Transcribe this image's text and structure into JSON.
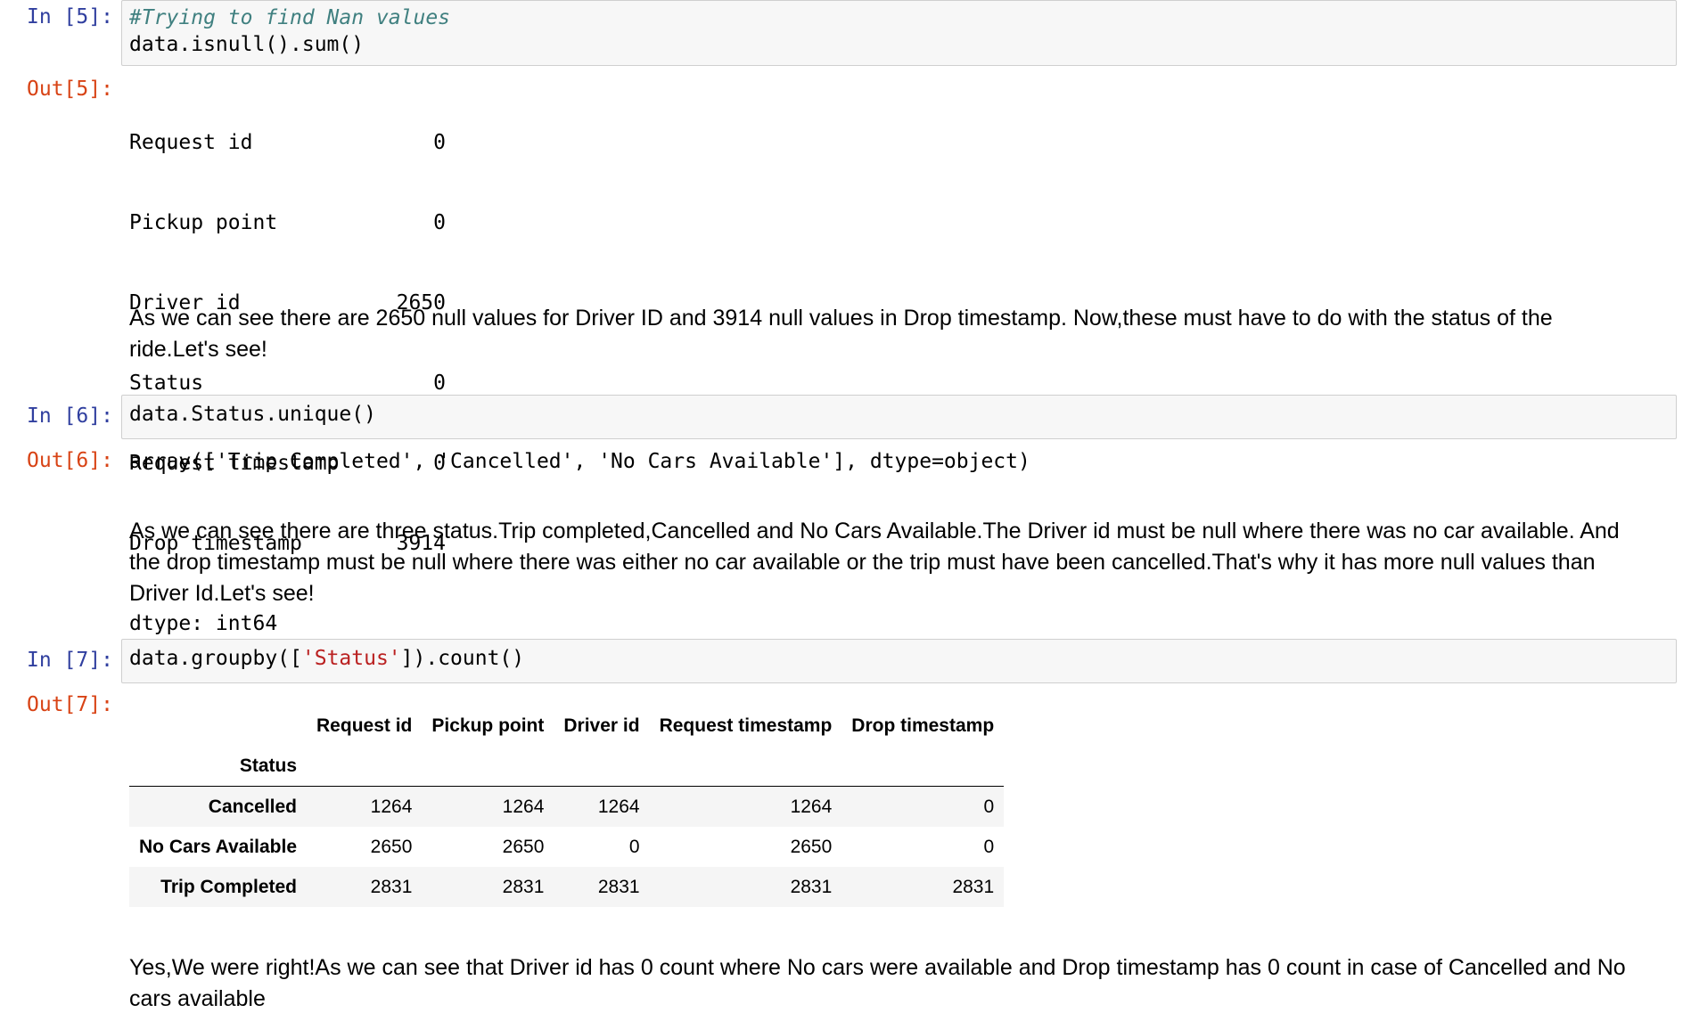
{
  "cells": {
    "in5": {
      "prompt": "In [5]:",
      "code": {
        "comment": "#Trying to find Nan values",
        "line2": "data.isnull().sum()"
      }
    },
    "out5": {
      "prompt": "Out[5]:",
      "series": [
        {
          "label": "Request id",
          "value": "0"
        },
        {
          "label": "Pickup point",
          "value": "0"
        },
        {
          "label": "Driver id",
          "value": "2650"
        },
        {
          "label": "Status",
          "value": "0"
        },
        {
          "label": "Request timestamp",
          "value": "0"
        },
        {
          "label": "Drop timestamp",
          "value": "3914"
        }
      ],
      "dtype": "dtype: int64"
    },
    "md1": {
      "text": "As we can see there are 2650 null values for Driver ID and 3914 null values in Drop timestamp. Now,these must have to do with the status of the ride.Let's see!"
    },
    "in6": {
      "prompt": "In [6]:",
      "code": "data.Status.unique()"
    },
    "out6": {
      "prompt": "Out[6]:",
      "text": "array(['Trip Completed', 'Cancelled', 'No Cars Available'], dtype=object)"
    },
    "md2": {
      "text": "As we can see there are three status.Trip completed,Cancelled and No Cars Available.The Driver id must be null where there was no car available. And the drop timestamp must be null where there was either no car available or the trip must have been cancelled.That's why it has more null values than Driver Id.Let's see!"
    },
    "in7": {
      "prompt": "In [7]:",
      "code_pre": "data.groupby([",
      "code_str": "'Status'",
      "code_post": "]).count()"
    },
    "out7": {
      "prompt": "Out[7]:",
      "table": {
        "columns": [
          "Request id",
          "Pickup point",
          "Driver id",
          "Request timestamp",
          "Drop timestamp"
        ],
        "index_name": "Status",
        "rows": [
          {
            "index": "Cancelled",
            "values": [
              "1264",
              "1264",
              "1264",
              "1264",
              "0"
            ]
          },
          {
            "index": "No Cars Available",
            "values": [
              "2650",
              "2650",
              "0",
              "2650",
              "0"
            ]
          },
          {
            "index": "Trip Completed",
            "values": [
              "2831",
              "2831",
              "2831",
              "2831",
              "2831"
            ]
          }
        ]
      }
    },
    "md3": {
      "text": "Yes,We were right!As we can see that Driver id has 0 count where No cars were available and Drop timestamp has 0 count in case of Cancelled and No cars available"
    }
  }
}
